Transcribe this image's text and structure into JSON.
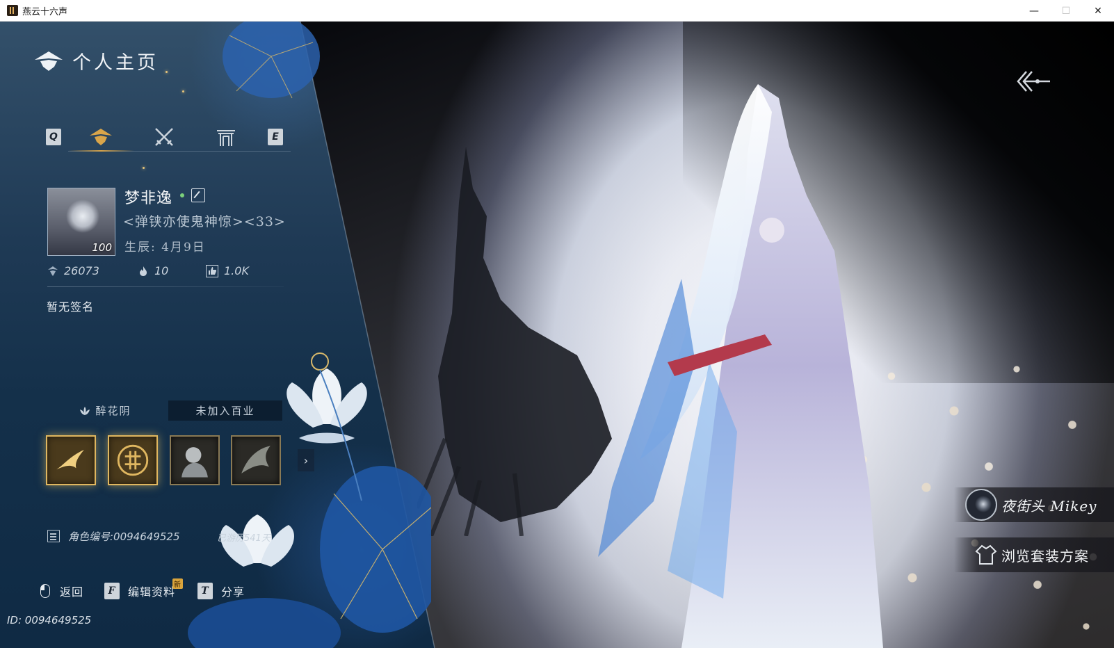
{
  "window": {
    "title": "燕云十六声",
    "minimize": "—",
    "maximize": "☐",
    "close": "✕"
  },
  "header": {
    "title": "个人主页"
  },
  "tabs": {
    "left_key": "Q",
    "right_key": "E",
    "items": [
      "profile-icon",
      "crossed-swords-icon",
      "gate-icon"
    ]
  },
  "profile": {
    "level": "100",
    "name": "梦非逸",
    "title": "<弹铗亦使鬼神惊><33>",
    "birthday": "生辰: 4月9日"
  },
  "stats": {
    "coins": "26073",
    "heat": "10",
    "likes": "1.0K"
  },
  "signature": "暂无签名",
  "guild": {
    "name": "醉花阴",
    "profession": "未加入百业"
  },
  "badges": [
    "swallow-badge",
    "seal-badge",
    "portrait-badge",
    "beast-badge"
  ],
  "role": {
    "id_label": "角色编号:0094649525",
    "days_label": "已游历541天"
  },
  "footer": {
    "back": "返回",
    "edit_key": "F",
    "edit": "编辑资料",
    "new": "新",
    "share_key": "T",
    "share": "分享"
  },
  "uid": "ID: 0094649525",
  "side": {
    "player": "夜街头 Mikey",
    "outfit": "浏览套装方案"
  },
  "colors": {
    "panel": "#1f3a55",
    "accent_gold": "#d9a54a"
  }
}
